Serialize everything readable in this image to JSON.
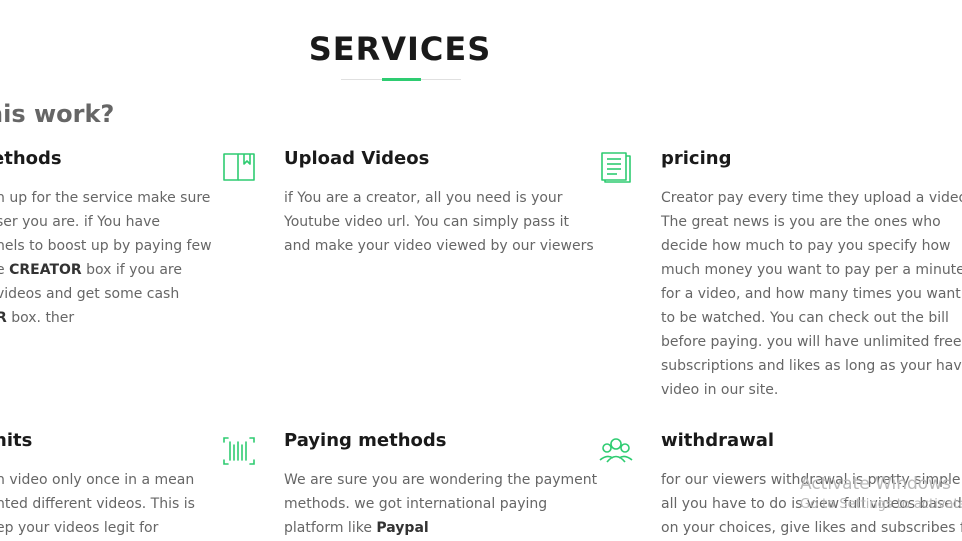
{
  "page": {
    "title": "SERVICES"
  },
  "section": {
    "heading": "his work?"
  },
  "cards": [
    {
      "title": "ethods",
      "icon": "none",
      "lines": [
        "n up for the service make sure",
        "ser you are. if You have",
        "nels to boost up by paying few",
        [
          "e ",
          "CREATOR",
          " box if you are"
        ],
        "videos and get some cash",
        [
          "",
          "R",
          " box. ther"
        ]
      ]
    },
    {
      "title": "Upload Videos",
      "icon": "book-icon",
      "lines": [
        "if You are a creator, all you need is your",
        "Youtube video url. You can simply pass it",
        "and make your video viewed by our viewers"
      ]
    },
    {
      "title": "pricing",
      "icon": "document-icon",
      "lines": [
        "Creator pay every time they upload a video.",
        "The great news is you are the ones who",
        "decide how much to pay you specify how",
        "much money you want to pay per a minute",
        "for a video, and how many times you want it",
        "to be watched. You can check out the bill",
        "before paying. you will have unlimited free",
        "subscriptions and likes as long as your have",
        "video in our site."
      ]
    },
    {
      "title": "nits",
      "icon": "none",
      "lines": [
        "n video only once in a mean",
        "nted different videos. This is",
        "ep your videos legit for"
      ]
    },
    {
      "title": "Paying methods",
      "icon": "barcode-icon",
      "lines": [
        "We are sure you are wondering the payment",
        "methods. we got international paying",
        [
          "platform like ",
          "Paypal",
          ""
        ]
      ]
    },
    {
      "title": "withdrawal",
      "icon": "people-icon",
      "lines": [
        "for our viewers withdrawal is pretty simple.",
        "all you have to do is view full videos based",
        "on your choices, give likes and subscribes for"
      ]
    }
  ],
  "watermark": {
    "line1": "Activate Windows",
    "line2": "Go to Settings to activate"
  },
  "colors": {
    "accent": "#2ecc71",
    "text": "#666666",
    "heading": "#1a1a1a"
  }
}
